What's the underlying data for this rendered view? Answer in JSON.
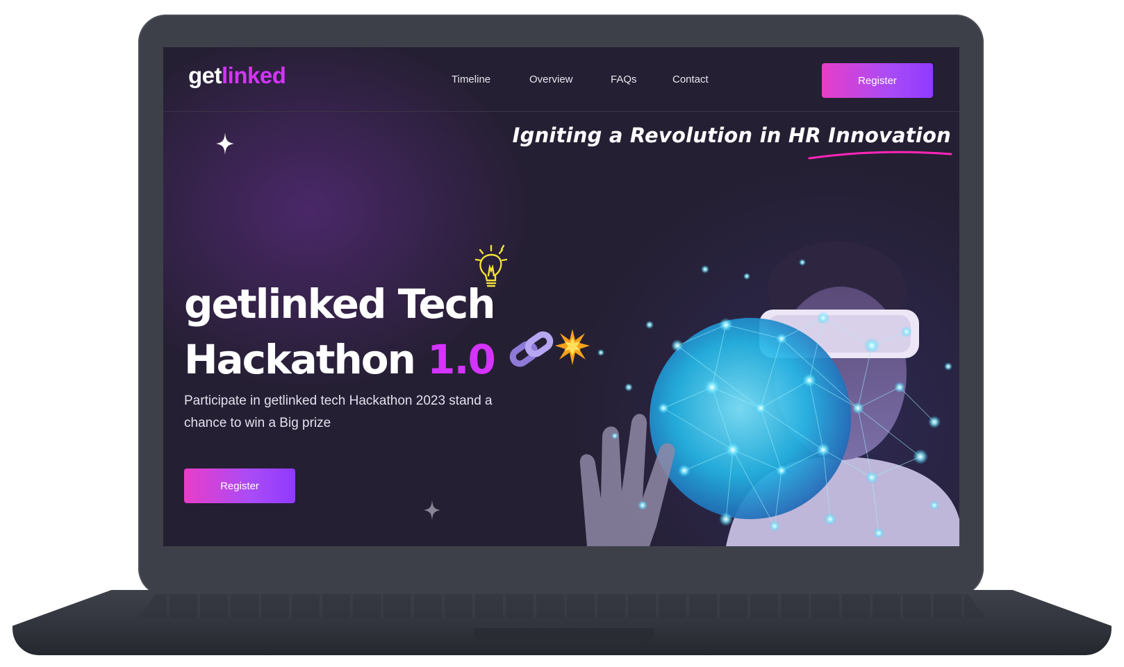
{
  "brand": {
    "logo_part1": "get",
    "logo_part2": "linked"
  },
  "nav": {
    "links": [
      "Timeline",
      "Overview",
      "FAQs",
      "Contact"
    ],
    "register_label": "Register"
  },
  "hero": {
    "tagline": "Igniting a Revolution in HR Innovation",
    "title_line1": "getlinked Tech",
    "title_line2": "Hackathon",
    "title_version": "1.0",
    "subtitle": "Participate in getlinked tech Hackathon 2023 stand a chance to win a Big prize",
    "register_label": "Register"
  },
  "icons": [
    "lightbulb-icon",
    "chain-link-icon",
    "spark-burst-icon",
    "star-icon"
  ],
  "colors": {
    "accent": "#d434fe",
    "gradient_start": "#e83ec8",
    "gradient_end": "#903aff",
    "background": "#251f33",
    "underline": "#ff26b9"
  }
}
